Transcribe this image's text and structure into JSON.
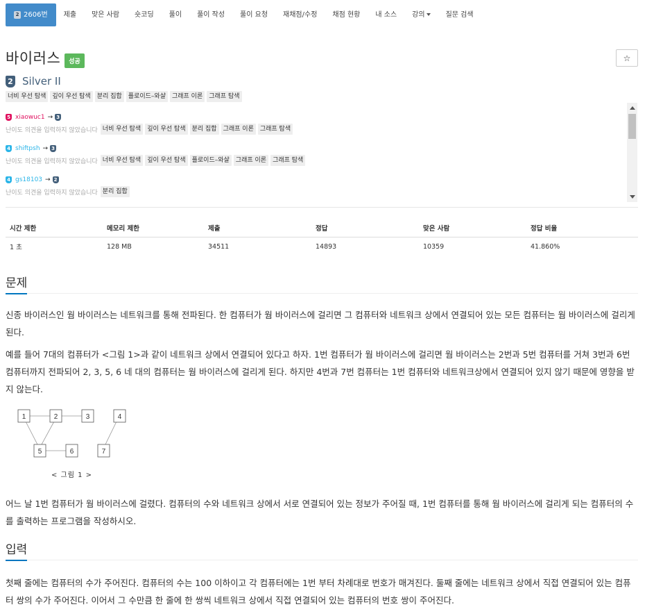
{
  "nav": {
    "active_tab": "2606번",
    "tabs": [
      "제출",
      "맞은 사람",
      "숏코딩",
      "풀이",
      "풀이 작성",
      "풀이 요청",
      "재채점/수정",
      "채점 현황",
      "내 소스",
      "강의",
      "질문 검색"
    ]
  },
  "problem": {
    "title": "바이러스",
    "status_badge": "성공",
    "star_icon": "☆",
    "tier_number": "2",
    "tier_name": "Silver II",
    "tags": [
      "너비 우선 탐색",
      "깊이 우선 탐색",
      "분리 집합",
      "플로이드–와샬",
      "그래프 이론",
      "그래프 탐색"
    ]
  },
  "opinions": [
    {
      "level": "5",
      "level_color": "#e0115f",
      "user": "xiaowuc1",
      "arrow": "→",
      "tier": "3",
      "note": "난이도 의견을 입력하지 않았습니다",
      "tags": [
        "너비 우선 탐색",
        "깊이 우선 탐색",
        "분리 집합",
        "그래프 이론",
        "그래프 탐색"
      ]
    },
    {
      "level": "4",
      "level_color": "#2bb5e8",
      "user": "shiftpsh",
      "arrow": "→",
      "tier": "3",
      "note": "난이도 의견을 입력하지 않았습니다",
      "tags": [
        "너비 우선 탐색",
        "깊이 우선 탐색",
        "플로이드–와샬",
        "그래프 이론",
        "그래프 탐색"
      ]
    },
    {
      "level": "4",
      "level_color": "#2bb5e8",
      "user": "gs18103",
      "arrow": "→",
      "tier": "2",
      "note": "난이도 의견을 입력하지 않았습니다",
      "tags": [
        "분리 집합"
      ]
    }
  ],
  "info": {
    "headers": [
      "시간 제한",
      "메모리 제한",
      "제출",
      "정답",
      "맞은 사람",
      "정답 비율"
    ],
    "values": [
      "1 초",
      "128 MB",
      "34511",
      "14893",
      "10359",
      "41.860%"
    ]
  },
  "sections": {
    "problem_title": "문제",
    "problem_p1": "신종 바이러스인 웜 바이러스는 네트워크를 통해 전파된다. 한 컴퓨터가 웜 바이러스에 걸리면 그 컴퓨터와 네트워크 상에서 연결되어 있는 모든 컴퓨터는 웜 바이러스에 걸리게 된다.",
    "problem_p2": "예를 들어 7대의 컴퓨터가 <그림 1>과 같이 네트워크 상에서 연결되어 있다고 하자. 1번 컴퓨터가 웜 바이러스에 걸리면 웜 바이러스는 2번과 5번 컴퓨터를 거쳐 3번과 6번 컴퓨터까지 전파되어 2, 3, 5, 6 네 대의 컴퓨터는 웜 바이러스에 걸리게 된다. 하지만 4번과 7번 컴퓨터는 1번 컴퓨터와 네트워크상에서 연결되어 있지 않기 때문에 영향을 받지 않는다.",
    "figure_caption": "< 그림 1 >",
    "figure_nodes": [
      "1",
      "2",
      "3",
      "4",
      "5",
      "6",
      "7"
    ],
    "problem_p3": "어느 날 1번 컴퓨터가 웜 바이러스에 걸렸다. 컴퓨터의 수와 네트워크 상에서 서로 연결되어 있는 정보가 주어질 때, 1번 컴퓨터를 통해 웜 바이러스에 걸리게 되는 컴퓨터의 수를 출력하는 프로그램을 작성하시오.",
    "input_title": "입력",
    "input_p1": "첫째 줄에는 컴퓨터의 수가 주어진다. 컴퓨터의 수는 100 이하이고 각 컴퓨터에는 1번 부터 차례대로 번호가 매겨진다. 둘째 줄에는 네트워크 상에서 직접 연결되어 있는 컴퓨터 쌍의 수가 주어진다. 이어서 그 수만큼 한 줄에 한 쌍씩 네트워크 상에서 직접 연결되어 있는 컴퓨터의 번호 쌍이 주어진다."
  }
}
